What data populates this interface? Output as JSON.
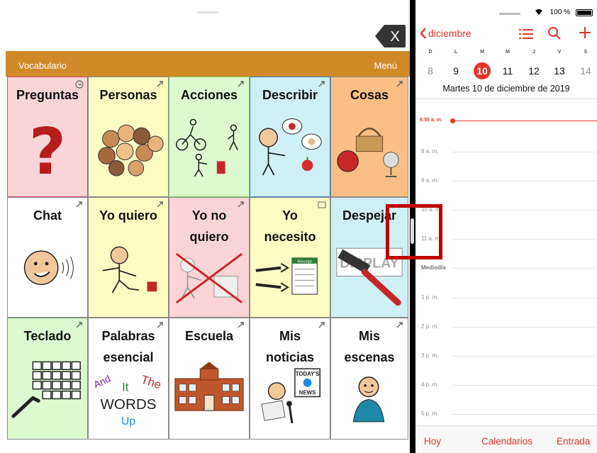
{
  "aac": {
    "toolbar": {
      "left_label": "Vocabulario",
      "right_label": "Menú"
    },
    "clear_button_label": "X",
    "colors": {
      "toolbar": "#d08a27",
      "pink": "#fbd4d7",
      "yellow": "#fdfcc3",
      "green": "#dcf9d0",
      "blue": "#cff0f5",
      "orange": "#fbbf86",
      "white": "#ffffff"
    },
    "cells": [
      {
        "label": "Preguntas",
        "icon": "question-mark-icon",
        "corner": "link-icon"
      },
      {
        "label": "Personas",
        "icon": "people-faces-icon",
        "corner": "link-icon"
      },
      {
        "label": "Acciones",
        "icon": "actions-icon",
        "corner": "link-icon"
      },
      {
        "label": "Describir",
        "icon": "describe-icon",
        "corner": "link-icon"
      },
      {
        "label": "Cosas",
        "icon": "things-icon",
        "corner": "link-icon"
      },
      {
        "label": "Chat",
        "icon": "chat-face-icon",
        "corner": "link-icon"
      },
      {
        "label": "Yo quiero",
        "icon": "i-want-icon",
        "corner": "link-icon"
      },
      {
        "label": "Yo no\nquiero",
        "icon": "i-dont-want-icon",
        "corner": "link-icon"
      },
      {
        "label": "Yo\nnecesito",
        "icon": "i-need-icon",
        "corner": "link-icon"
      },
      {
        "label": "Despejar",
        "icon": "squeegee-icon",
        "corner": ""
      },
      {
        "label": "Teclado",
        "icon": "keyboard-icon",
        "corner": "link-icon"
      },
      {
        "label": "Palabras\nesencial",
        "icon": "words-icon",
        "corner": "link-icon",
        "pic_words": [
          "And",
          "It",
          "The",
          "WORDS",
          "Up"
        ]
      },
      {
        "label": "Escuela",
        "icon": "school-icon",
        "corner": "link-icon"
      },
      {
        "label": "Mis\nnoticias",
        "icon": "news-icon",
        "corner": "link-icon",
        "pic_words": [
          "TODAY'S",
          "NEWS"
        ]
      },
      {
        "label": "Mis\nescenas",
        "icon": "scenes-icon",
        "corner": "link-icon"
      }
    ],
    "cell_pic_texts": {
      "receipt": "Receipt",
      "display": "DISPLAY"
    }
  },
  "calendar": {
    "status": {
      "battery": "100 %"
    },
    "back_label": "diciembre",
    "weekdays": [
      "D",
      "L",
      "M",
      "M",
      "J",
      "V",
      "S"
    ],
    "days": [
      "8",
      "9",
      "10",
      "11",
      "12",
      "13",
      "14"
    ],
    "today_index": 2,
    "selected_date": "Martes  10 de diciembre de 2019",
    "now_label": "6:55 a. m.",
    "hours": [
      "8 a. m.",
      "9 a. m.",
      "10 a. m.",
      "11 a. m.",
      "Mediodía",
      "1 p. m.",
      "2 p. m.",
      "3 p. m.",
      "4 p. m.",
      "5 p. m."
    ],
    "bottom": {
      "today": "Hoy",
      "calendars": "Calendarios",
      "inbox": "Entrada"
    },
    "accent": "#e5342a"
  }
}
